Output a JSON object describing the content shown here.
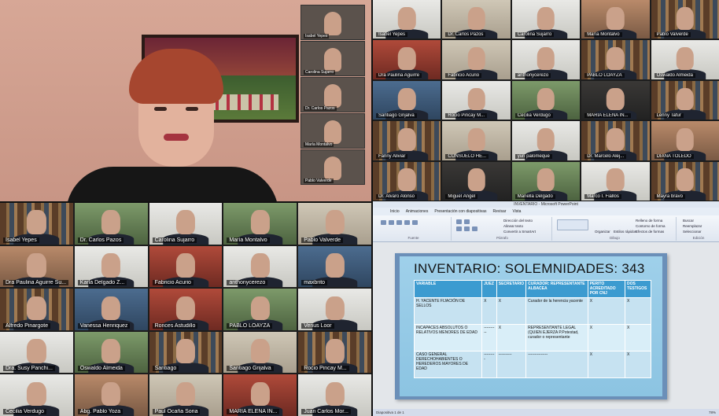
{
  "speaker_view": {
    "thumbnails": [
      {
        "name": "Isabel Yepes"
      },
      {
        "name": "Carolina Sujarro"
      },
      {
        "name": "Dr. Carlos Pazos"
      },
      {
        "name": "María Montalvo"
      },
      {
        "name": "Pablo Valverde"
      }
    ]
  },
  "gallery_top_right": {
    "tiles": [
      {
        "name": "Isabel Yepes",
        "bg": "bg-white"
      },
      {
        "name": "Dr. Carlos Pazos",
        "bg": "bg-wall"
      },
      {
        "name": "Carolina Sujarro",
        "bg": "bg-white"
      },
      {
        "name": "María Montalvo",
        "bg": "bg-warm"
      },
      {
        "name": "Pablo Valverde",
        "bg": "bg-shelf"
      },
      {
        "name": "Dra Paulina Aguirre",
        "bg": "bg-red"
      },
      {
        "name": "Fabricio Acurio",
        "bg": "bg-wall"
      },
      {
        "name": "anthonycerezo",
        "bg": "bg-white"
      },
      {
        "name": "PABLO LOAYZA",
        "bg": "bg-shelf"
      },
      {
        "name": "Oswaldo Almeida",
        "bg": "bg-white"
      },
      {
        "name": "Santiago Grijalva",
        "bg": "bg-blue"
      },
      {
        "name": "Rocio Pincay M...",
        "bg": "bg-white"
      },
      {
        "name": "Cecilia Verdugo",
        "bg": "bg-green"
      },
      {
        "name": "MARIA ELENA IN...",
        "bg": "bg-dark"
      },
      {
        "name": "Lenny Tafur",
        "bg": "bg-shelf"
      },
      {
        "name": "Fanny Aliviar",
        "bg": "bg-shelf"
      },
      {
        "name": "CONSUELO HE...",
        "bg": "bg-wall"
      },
      {
        "name": "yuri palomeque",
        "bg": "bg-white"
      },
      {
        "name": "Dr. Marcelo Alej...",
        "bg": "bg-shelf"
      },
      {
        "name": "DIANA TOLEDO",
        "bg": "bg-warm"
      },
      {
        "name": "Dr. Álvaro Alonso",
        "bg": "bg-shelf"
      },
      {
        "name": "Miguel Ángel",
        "bg": "bg-dark"
      },
      {
        "name": "Mariella Delgado",
        "bg": "bg-green"
      },
      {
        "name": "Marco I. Fiallos",
        "bg": "bg-white"
      },
      {
        "name": "Mayra bravo",
        "bg": "bg-shelf"
      }
    ]
  },
  "gallery_bottom_left": {
    "tiles": [
      {
        "name": "Isabel Yepes",
        "bg": "bg-shelf",
        "active": true
      },
      {
        "name": "Dr. Carlos Pazos",
        "bg": "bg-green"
      },
      {
        "name": "Carolina Sujarro",
        "bg": "bg-white"
      },
      {
        "name": "María Montalvo",
        "bg": "bg-green"
      },
      {
        "name": "Pablo Valverde",
        "bg": "bg-wall"
      },
      {
        "name": "Dra Paulina Aguirre Su...",
        "bg": "bg-warm"
      },
      {
        "name": "Karla Delgado Z...",
        "bg": "bg-white"
      },
      {
        "name": "Fabricio Acurio",
        "bg": "bg-red"
      },
      {
        "name": "anthonycerezo",
        "bg": "bg-white"
      },
      {
        "name": "maxbrito",
        "bg": "bg-blue"
      },
      {
        "name": "Alfredo Pinargote",
        "bg": "bg-shelf"
      },
      {
        "name": "Vanessa Henriquez",
        "bg": "bg-blue"
      },
      {
        "name": "Ronces Astudillo",
        "bg": "bg-red"
      },
      {
        "name": "PABLO LOAYZA",
        "bg": "bg-green"
      },
      {
        "name": "Venus Loor",
        "bg": "bg-white"
      },
      {
        "name": "Dra. Susy Panchi...",
        "bg": "bg-white"
      },
      {
        "name": "Oswaldo Almeida",
        "bg": "bg-green"
      },
      {
        "name": "Santiago",
        "bg": "bg-shelf"
      },
      {
        "name": "Santiago Grijalva",
        "bg": "bg-wall"
      },
      {
        "name": "Rocio Pincay M...",
        "bg": "bg-shelf"
      },
      {
        "name": "Cecilia Verdugo",
        "bg": "bg-white"
      },
      {
        "name": "Abg. Pablo Yoza",
        "bg": "bg-warm"
      },
      {
        "name": "Paul Ocaña Soria",
        "bg": "bg-wall"
      },
      {
        "name": "MARIA ELENA IN...",
        "bg": "bg-red"
      },
      {
        "name": "Juan Carlos Mor...",
        "bg": "bg-white"
      }
    ]
  },
  "powerpoint": {
    "window_title": "INVENTARIO - Microsoft PowerPoint",
    "tabs": [
      "Inicio",
      "Animaciones",
      "Presentación con diapositivas",
      "Revisar",
      "Vista"
    ],
    "ribbon": {
      "group_font": "Fuente",
      "group_paragraph": "Párrafo",
      "group_drawing": "Dibujo",
      "group_editing": "Edición",
      "text_direction": "Dirección del texto",
      "align_text": "Alinear texto",
      "smartart": "Convertir a SmartArt",
      "arrange": "Organizar",
      "quick_styles": "Estilos rápidos",
      "shape_fill": "Relleno de forma",
      "shape_outline": "Contorno de forma",
      "shape_effects": "Efectos de formas",
      "find": "Buscar",
      "replace": "Reemplazar",
      "select": "Seleccionar"
    },
    "slide": {
      "title": "INVENTARIO: SOLEMNIDADES: 343",
      "headers": [
        "VARIABLE",
        "JUEZ",
        "SECRETARIO",
        "CURADOR: REPRESENTANTE ALBACEA",
        "PERITO ACREDITADO POR CNJ",
        "DOS TESTIGOS"
      ],
      "rows": [
        [
          "H. YACENTE FIJACIÓN DE SELLOS",
          "X",
          "X",
          "Curador de la herencia yacente",
          "X",
          "X"
        ],
        [
          "INCAPACES ABSOLUTOS O RELATIVOS MENORES DE EDAD",
          "----------",
          "X",
          "REPRESENTANTE LEGAL (QUIEN EJERZA P.Potestad, curador o representante",
          "X",
          "X"
        ],
        [
          "CASO GENERAL DERECHOHABIENTES O HEREDEROS MAYORES DE EDAD",
          "---------",
          "----------",
          "---------------",
          "X",
          "X"
        ]
      ]
    },
    "status": {
      "left": "Diapositiva 1 de 1",
      "zoom": "78%"
    }
  }
}
